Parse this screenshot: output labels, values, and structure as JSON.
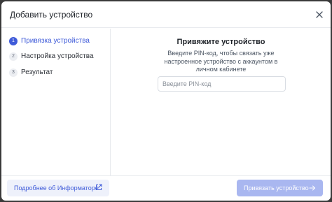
{
  "dialog": {
    "title": "Добавить устройство",
    "close_icon": "close-icon"
  },
  "steps": [
    {
      "number": "1",
      "label": "Привязка устройства",
      "active": true
    },
    {
      "number": "2",
      "label": "Настройка устройства",
      "active": false
    },
    {
      "number": "3",
      "label": "Результат",
      "active": false
    }
  ],
  "main": {
    "heading": "Привяжите устройство",
    "description": "Введите PIN-код, чтобы связать уже настроенное устройство с аккаунтом в личном кабинете",
    "pin_input": {
      "value": "",
      "placeholder": "Введите PIN-код"
    }
  },
  "footer": {
    "info_link_label": "Подробнее об Информаторе",
    "info_link_icon": "external-link-icon",
    "submit_label": "Привязать устройство",
    "submit_icon": "arrow-right-icon",
    "submit_disabled": true
  },
  "colors": {
    "accent": "#3f5bd9",
    "accent_disabled": "#a9b7f0",
    "info_bg": "#eef1fb",
    "backdrop": "#3a3a3a"
  }
}
